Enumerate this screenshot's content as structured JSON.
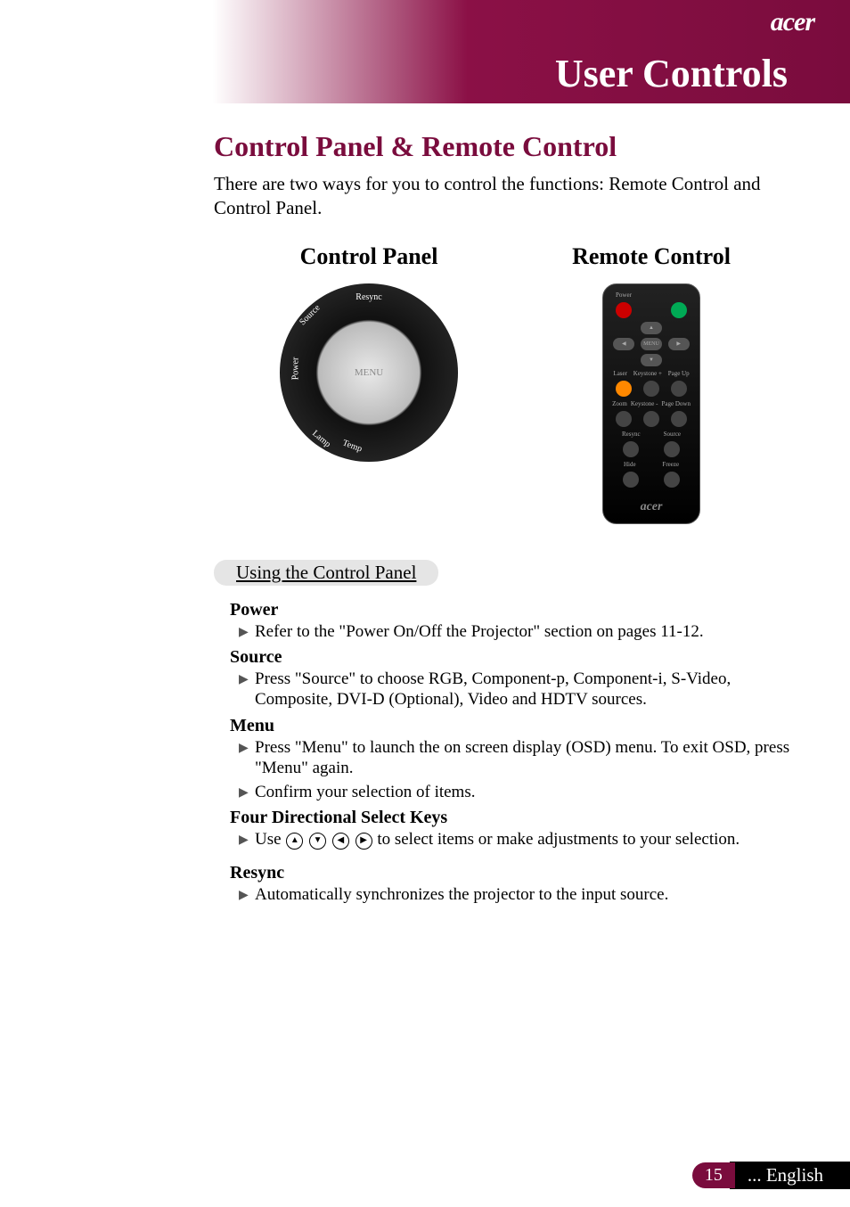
{
  "header": {
    "brand": "acer",
    "title": "User Controls"
  },
  "main": {
    "section_title": "Control Panel & Remote Control",
    "intro": "There are two ways for you to control the functions: Remote Control and Control Panel.",
    "col_left_head": "Control Panel",
    "col_right_head": "Remote Control"
  },
  "panel_labels": {
    "menu": "MENU",
    "resync": "Resync",
    "source": "Source",
    "power": "Power",
    "lamp": "Lamp",
    "temp": "Temp"
  },
  "remote_labels": {
    "power": "Power",
    "menu": "MENU",
    "laser": "Laser",
    "keystone_plus": "Keystone +",
    "page_up": "Page Up",
    "zoom": "Zoom",
    "keystone_minus": "Keystone -",
    "page_down": "Page Down",
    "resync": "Resync",
    "source": "Source",
    "hide": "Hide",
    "freeze": "Freeze",
    "brand": "acer"
  },
  "subsection": {
    "title": "Using the Control Panel",
    "items": [
      {
        "head": "Power",
        "bullets": [
          "Refer to the \"Power On/Off the Projector\" section on pages 11-12."
        ]
      },
      {
        "head": "Source",
        "bullets": [
          "Press \"Source\" to choose RGB, Component-p, Component-i, S-Video, Composite, DVI-D (Optional), Video and HDTV sources."
        ]
      },
      {
        "head": "Menu",
        "bullets": [
          "Press \"Menu\" to launch the on screen display (OSD) menu. To exit OSD, press \"Menu\" again.",
          "Confirm your selection of items."
        ]
      },
      {
        "head": "Four Directional Select Keys",
        "bullets_special": {
          "prefix": "Use ",
          "suffix": " to select items or make adjustments to your selection."
        }
      },
      {
        "head": "Resync",
        "bullets": [
          "Automatically synchronizes the projector to the input source."
        ]
      }
    ]
  },
  "footer": {
    "page_number": "15",
    "language": "... English"
  }
}
